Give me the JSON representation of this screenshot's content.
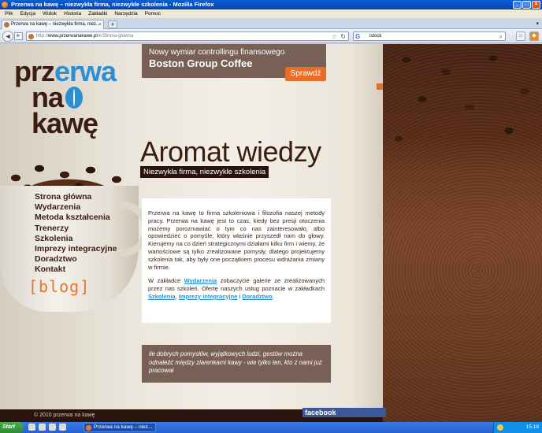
{
  "window": {
    "title": "Przerwa na kawę – niezwykła firma, niezwykłe szkolenia - Mozilla Firefox",
    "buttons": [
      "_",
      "□",
      "×"
    ]
  },
  "menubar": [
    "Plik",
    "Edycja",
    "Widok",
    "Historia",
    "Zakładki",
    "Narzędzia",
    "Pomoc"
  ],
  "tab": {
    "label": "Przerwa na kawę – niezwykła firma, niez...",
    "close": "×",
    "new_tab": "+",
    "tab_list": "▾"
  },
  "nav": {
    "back": "◄",
    "forward": "►",
    "url_prefix": "http://",
    "url_domain": "www.przerwanakawe.pl",
    "url_path": "/#/Strona-glowna",
    "search_value": "istock",
    "search_engine": "G"
  },
  "site": {
    "logo": {
      "l1a": "prz",
      "l1b": "erwa",
      "l2": "na",
      "l3": "kawę"
    },
    "menu": [
      "Strona główna",
      "Wydarzenia",
      "Metoda kształcenia",
      "Trenerzy",
      "Szkolenia",
      "Imprezy integracyjne",
      "Doradztwo",
      "Kontakt"
    ],
    "blog": "[blog]",
    "banner": {
      "sub": "Nowy wymiar controllingu finansowego",
      "main": "Boston Group Coffee",
      "button": "Sprawdź"
    },
    "headline": "Aromat wiedzy",
    "tagline": "Niezwykła firma, niezwykłe szkolenia",
    "content": {
      "p1": "Przerwa na kawę to firma szkoleniowa i filozofia naszej metody pracy. Przerwa na kawę jest to czas, kiedy bez presji otoczenia możemy porozmawiać o tym co nas zainteresowało, albo opowiedzieć o pomyśle, który właśnie przyszedł nam do głowy. Kierujemy na co dzień strategicznymi działami kilku firm i wiemy, że wartościowe są tylko zrealizowane pomysły, dlatego projektujemy szkolenia tak, aby były one początkiem procesu wdrażania zmiany w firmie.",
      "p2_a": "W zakładce ",
      "p2_link1": "Wydarzenia",
      "p2_b": " zobaczycie galerie ze zrealizowanych przez nas szkoleń. Ofertę naszych usług poznacie w zakładkach ",
      "p2_link2": "Szkolenia",
      "p2_c": ", ",
      "p2_link3": "Imprezy integracyjne",
      "p2_d": " i ",
      "p2_link4": "Doradztwo",
      "p2_e": "."
    },
    "quote_mark": "„",
    "quote": "ile dobrych pomysłów, wyjątkowych ludzi, gestów można odnaleźć między ziarenkami kawy - wie tylko ten, kto z nami już pracował",
    "footer": "© 2010 przerwa na kawę",
    "facebook": "facebook"
  },
  "taskbar": {
    "start": "Start",
    "task": "Przerwa na kawę – niez...",
    "clock": "15:18"
  }
}
